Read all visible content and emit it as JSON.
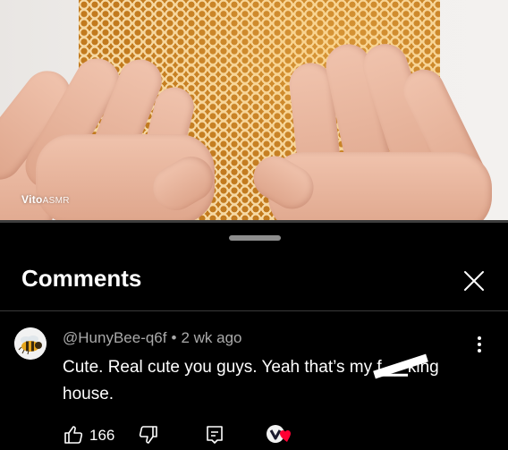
{
  "video": {
    "watermark_brand": "Vito",
    "watermark_suffix": "ASMR"
  },
  "panel": {
    "title": "Comments",
    "close_icon": "close-icon"
  },
  "comment": {
    "avatar_icon": "bee-avatar",
    "author": "@HunyBee-q6f",
    "separator": "•",
    "time": "2 wk ago",
    "text_before": "Cute. Real cute you guys. Yeah that’s my ",
    "text_censored": "f▁▁king",
    "text_after": " house.",
    "like_count": "166",
    "icons": [
      "thumbs-up-icon",
      "thumbs-down-icon",
      "reply-icon",
      "creator-heart-icon",
      "more-vert-icon"
    ]
  },
  "colors": {
    "background": "#000000",
    "meta_text": "#aaaaaa",
    "handle": "#8e8e8e",
    "heart": "#ff0033"
  }
}
